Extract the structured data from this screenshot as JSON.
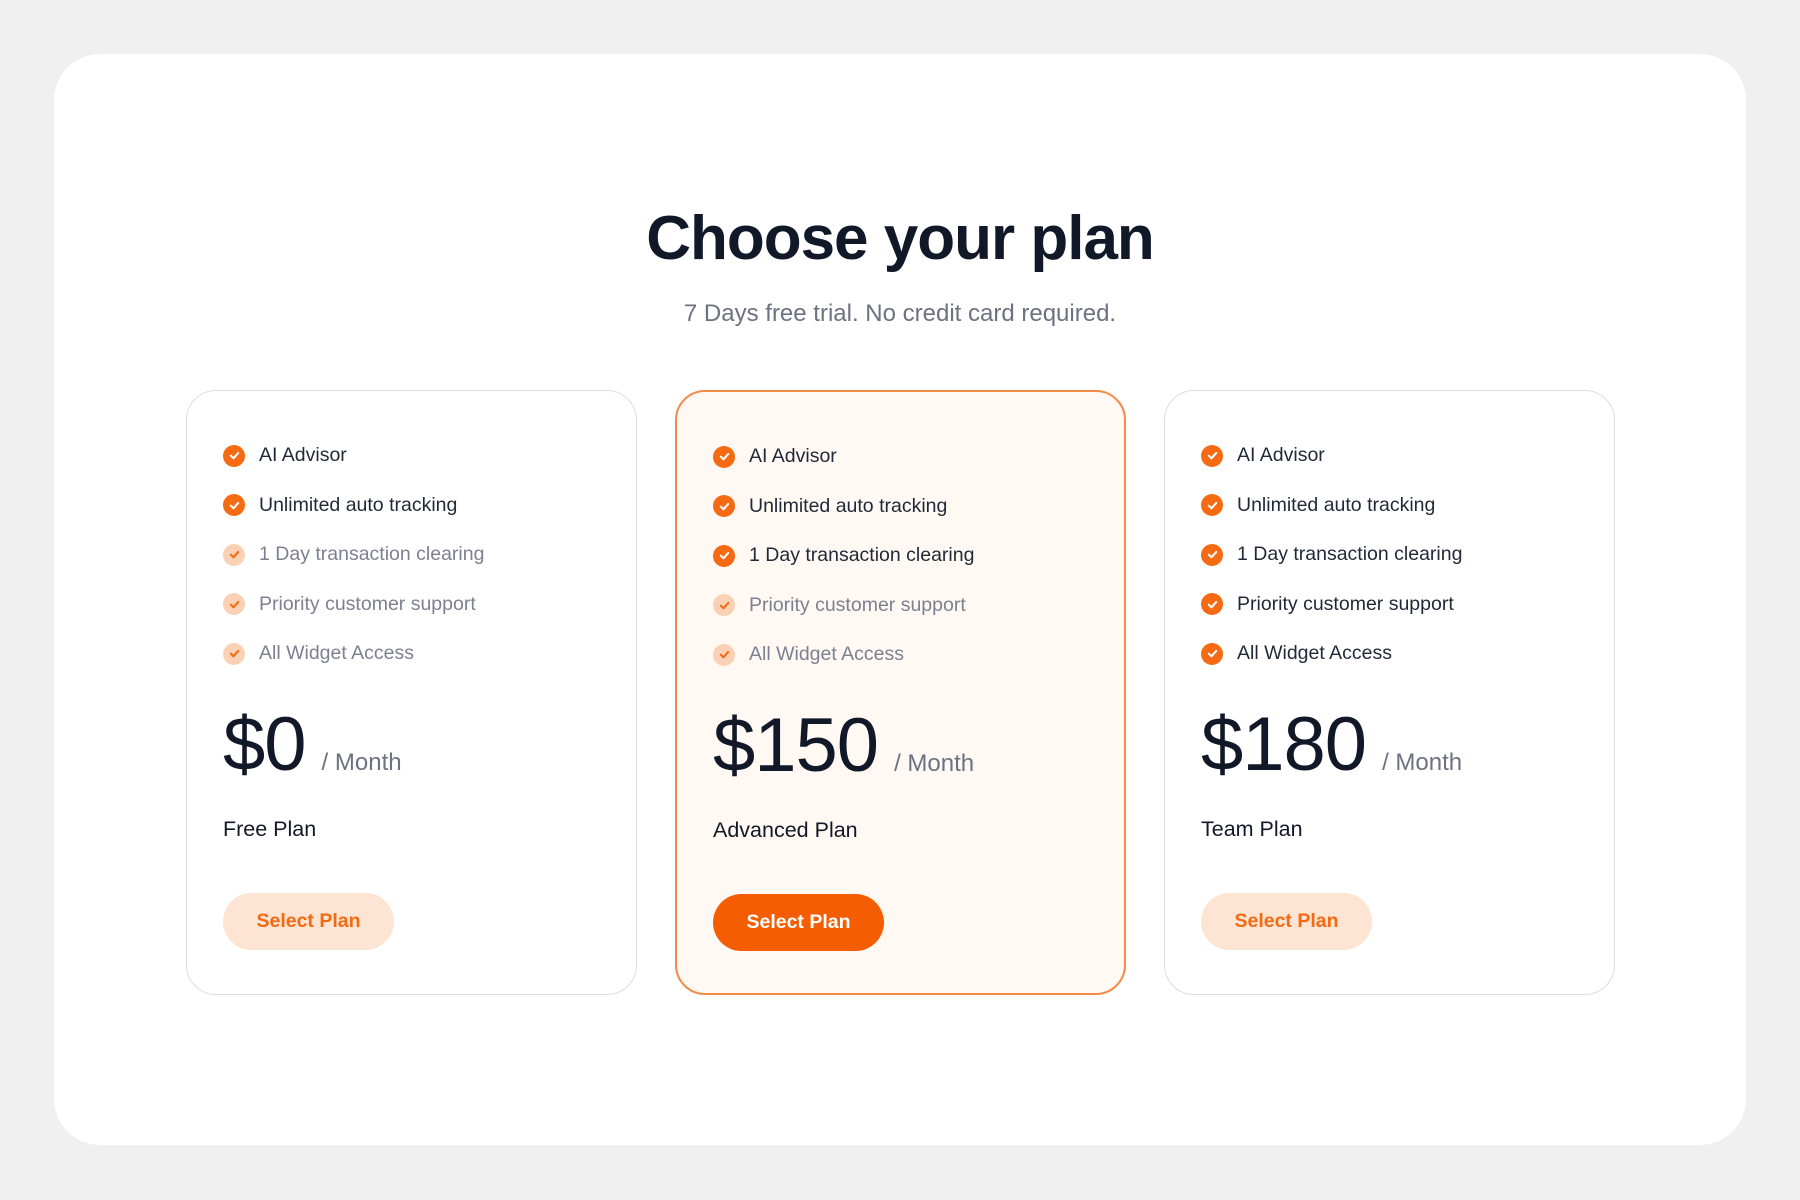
{
  "header": {
    "title": "Choose your plan",
    "subtitle": "7 Days free trial. No credit card required."
  },
  "colors": {
    "accent": "#f45d02",
    "accent_soft": "#fde4d3",
    "featured_border": "#f28a48",
    "featured_background": "#fff8f3"
  },
  "plans": [
    {
      "price": "$0",
      "period": "/ Month",
      "name": "Free Plan",
      "button_label": "Select Plan",
      "featured": false,
      "features": [
        {
          "label": "AI Advisor",
          "included": true,
          "icon": "check-circle-icon"
        },
        {
          "label": "Unlimited auto tracking",
          "included": true,
          "icon": "check-circle-icon"
        },
        {
          "label": "1 Day transaction clearing",
          "included": false,
          "icon": "check-circle-icon"
        },
        {
          "label": "Priority customer support",
          "included": false,
          "icon": "check-circle-icon"
        },
        {
          "label": "All Widget Access",
          "included": false,
          "icon": "check-circle-icon"
        }
      ]
    },
    {
      "price": "$150",
      "period": "/ Month",
      "name": "Advanced Plan",
      "button_label": "Select Plan",
      "featured": true,
      "features": [
        {
          "label": "AI Advisor",
          "included": true,
          "icon": "check-circle-icon"
        },
        {
          "label": "Unlimited auto tracking",
          "included": true,
          "icon": "check-circle-icon"
        },
        {
          "label": "1 Day transaction clearing",
          "included": true,
          "icon": "check-circle-icon"
        },
        {
          "label": "Priority customer support",
          "included": false,
          "icon": "check-circle-icon"
        },
        {
          "label": "All Widget Access",
          "included": false,
          "icon": "check-circle-icon"
        }
      ]
    },
    {
      "price": "$180",
      "period": "/ Month",
      "name": "Team Plan",
      "button_label": "Select Plan",
      "featured": false,
      "features": [
        {
          "label": "AI Advisor",
          "included": true,
          "icon": "check-circle-icon"
        },
        {
          "label": "Unlimited auto tracking",
          "included": true,
          "icon": "check-circle-icon"
        },
        {
          "label": "1 Day transaction clearing",
          "included": true,
          "icon": "check-circle-icon"
        },
        {
          "label": "Priority customer support",
          "included": true,
          "icon": "check-circle-icon"
        },
        {
          "label": "All Widget Access",
          "included": true,
          "icon": "check-circle-icon"
        }
      ]
    }
  ]
}
